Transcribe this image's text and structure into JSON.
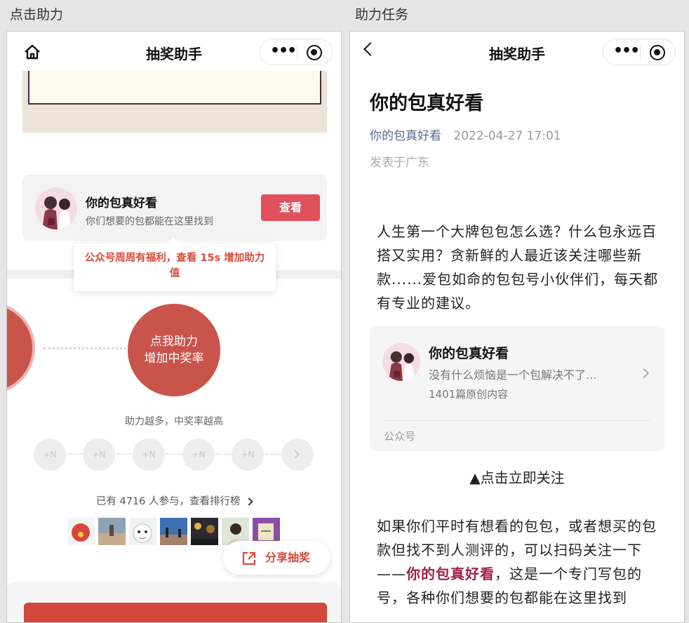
{
  "captions": {
    "left": "点击助力",
    "right": "助力任务"
  },
  "left": {
    "nav_title": "抽奖助手",
    "account_card": {
      "name": "你的包真好看",
      "desc": "你们想要的包都能在这里找到",
      "button": "查看"
    },
    "tooltip": "公众号周周有福利，查看 15s 增加助力值",
    "help_button_line1": "点我助力",
    "help_button_line2": "增加中奖率",
    "help_hint": "助力越多，中奖率越高",
    "nodes": [
      "+N",
      "+N",
      "+N",
      "+N",
      "+N"
    ],
    "participants": {
      "prefix": "已有",
      "count": "4716",
      "suffix": "人参与，查看排行榜"
    },
    "share_button": "分享抽奖"
  },
  "right": {
    "nav_title": "抽奖助手",
    "article_title": "你的包真好看",
    "author": "你的包真好看",
    "datetime": "2022-04-27 17:01",
    "location": "发表于广东",
    "paragraph1": "人生第一个大牌包包怎么选？什么包永远百搭又实用？贪新鲜的人最近该关注哪些新款......爱包如命的包包号小伙伴们，每天都有专业的建议。",
    "account_card": {
      "name": "你的包真好看",
      "desc": "没有什么烦恼是一个包解决不了...",
      "count": "1401篇原创内容",
      "type": "公众号"
    },
    "follow": "▲点击立即关注",
    "paragraph2_start": "如果你们平时有想看的包包，或者想买的包款但找不到人测评的，可以扫码关注一下——",
    "paragraph2_link": "你的包真好看",
    "paragraph2_end": "，这是一个专门写包的号，各种你们想要的包都能在这里找到"
  },
  "colors": {
    "accent_red": "#c9544b",
    "button_red": "#e0505a",
    "link_blue": "#576b95"
  }
}
